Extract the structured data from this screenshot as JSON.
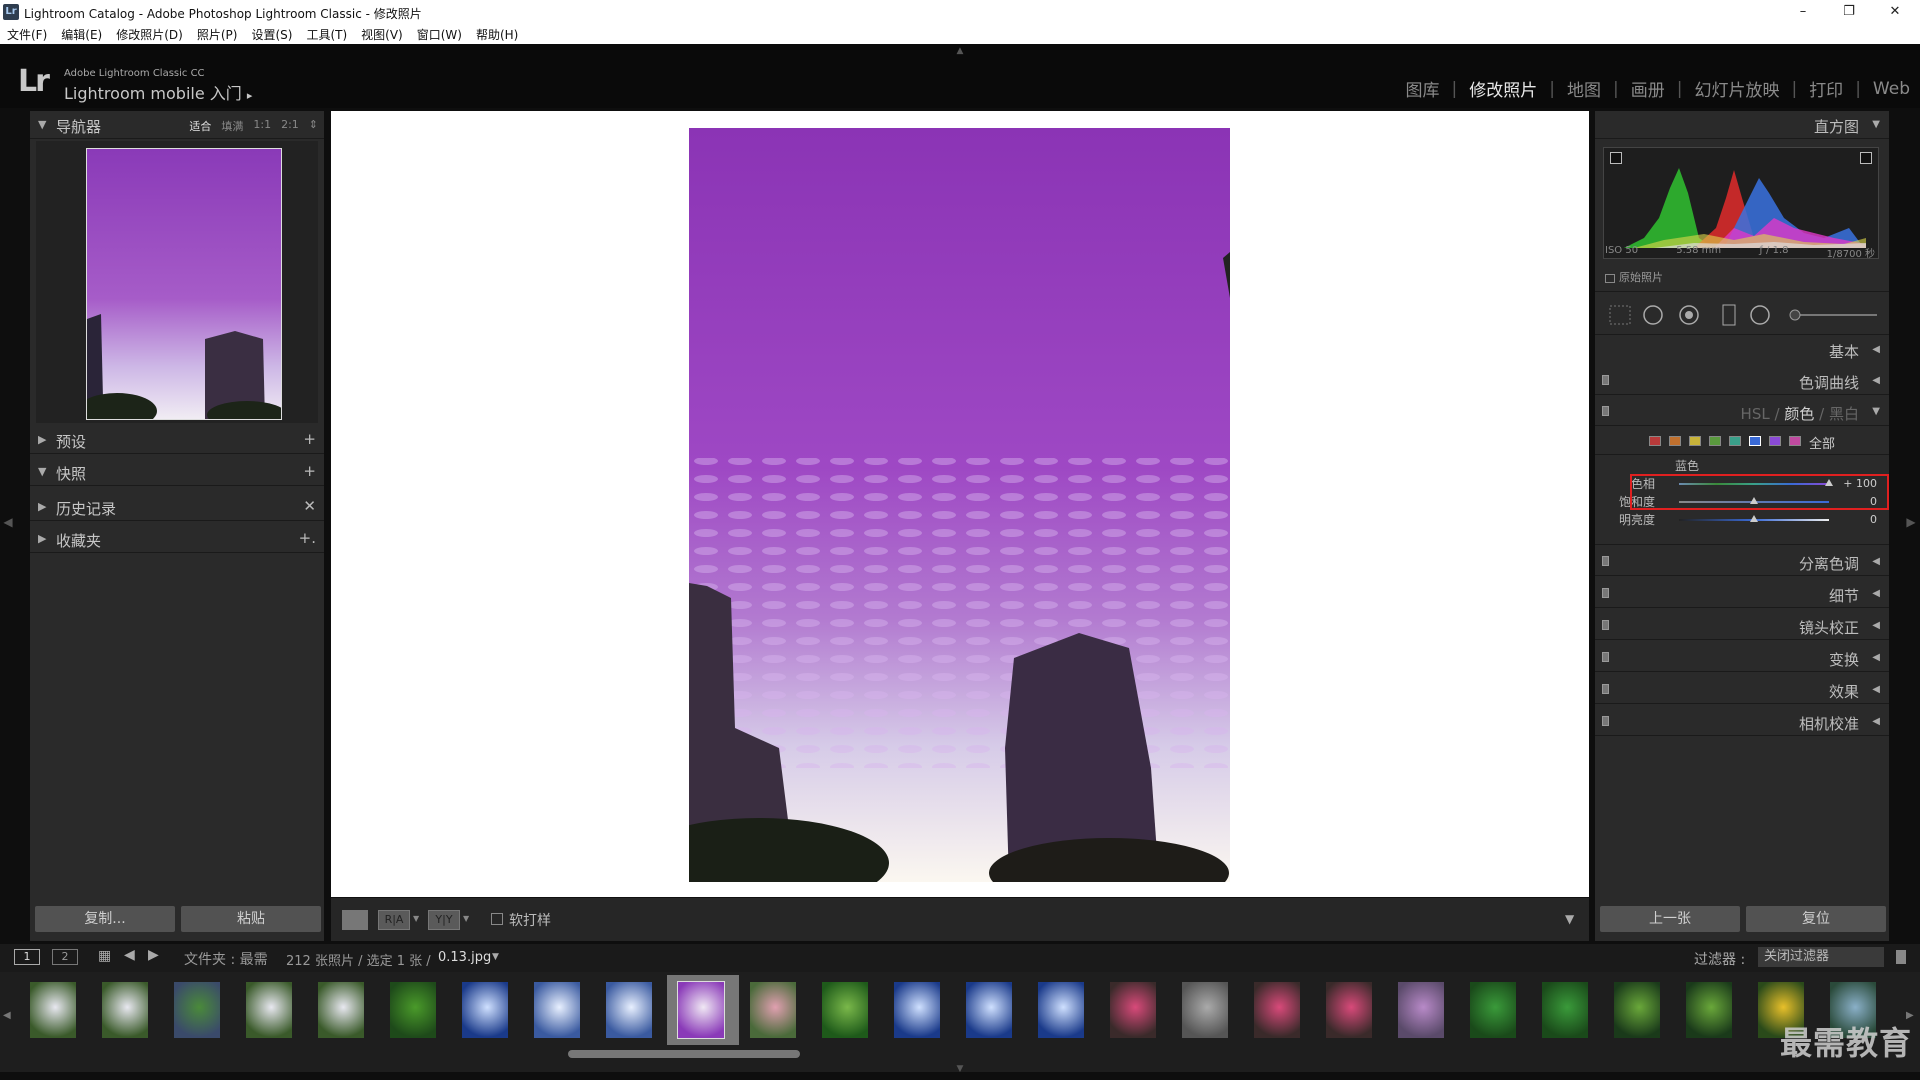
{
  "window": {
    "title": "Lightroom Catalog - Adobe Photoshop Lightroom Classic - 修改照片",
    "logo_text": "Lr",
    "minimize": "–",
    "restore": "❐",
    "close": "✕"
  },
  "menu": [
    "文件(F)",
    "编辑(E)",
    "修改照片(D)",
    "照片(P)",
    "设置(S)",
    "工具(T)",
    "视图(V)",
    "窗口(W)",
    "帮助(H)"
  ],
  "identity": {
    "lr": "Lr",
    "product": "Adobe Lightroom Classic CC",
    "mobile": "Lightroom mobile 入门",
    "arrow": "▸"
  },
  "modules": [
    "图库",
    "修改照片",
    "地图",
    "画册",
    "幻灯片放映",
    "打印",
    "Web"
  ],
  "active_module": "修改照片",
  "left_panel": {
    "navigator": {
      "label": "导航器",
      "options": [
        "适合",
        "填满",
        "1:1",
        "2:1"
      ],
      "dropdown": "⇕"
    },
    "sections": [
      {
        "label": "预设",
        "action": "+"
      },
      {
        "label": "快照",
        "action": "+"
      },
      {
        "label": "历史记录",
        "action": "✕"
      },
      {
        "label": "收藏夹",
        "action": "+."
      }
    ],
    "copy_button": "复制...",
    "paste_button": "粘贴"
  },
  "toolbar": {
    "view_ra": "R|A",
    "view_yy": "Y|Y",
    "softproof_label": "软打样",
    "softproof_checked": false
  },
  "right_panel": {
    "histogram_label": "直方图",
    "hist_info": [
      "ISO 50",
      "5.58 mm",
      "ƒ / 1.8",
      "1/8700 秒"
    ],
    "original_photo": "原始照片",
    "sections_top": [
      {
        "label": "基本"
      },
      {
        "label": "色调曲线"
      }
    ],
    "hsl_tabs": [
      "HSL",
      "/",
      "颜色",
      "/",
      "黑白"
    ],
    "hsl_active": "颜色",
    "color_all": "全部",
    "swatch_colors": [
      "#b83a3a",
      "#c0702e",
      "#c8b33a",
      "#5a9a3e",
      "#3aa08a",
      "#3a6ad6",
      "#8a4ad6",
      "#c04aa0"
    ],
    "selected_color_label": "蓝色",
    "sliders": [
      {
        "label": "色相",
        "value": "+ 100",
        "level": 1.0
      },
      {
        "label": "饱和度",
        "value": "0",
        "level": 0.5
      },
      {
        "label": "明亮度",
        "value": "0",
        "level": 0.5
      }
    ],
    "sections_bottom": [
      {
        "label": "分离色调"
      },
      {
        "label": "细节"
      },
      {
        "label": "镜头校正"
      },
      {
        "label": "变换"
      },
      {
        "label": "效果"
      },
      {
        "label": "相机校准"
      }
    ],
    "prev_button": "上一张",
    "reset_button": "复位"
  },
  "filmstrip_bar": {
    "view1": "1",
    "view2": "2",
    "source": "文件夹 : 最需",
    "count": "212 张照片 / 选定 1 张 /",
    "filename": "0.13.jpg",
    "filter_label": "过滤器 :",
    "filter_value": "关闭过滤器"
  },
  "filmstrip_thumbs": [
    "white-flowers",
    "white-flowers",
    "potted-plant",
    "white-flowers",
    "white-flowers",
    "green-leaves",
    "blue-sky",
    "sky-clouds",
    "sky-clouds",
    "purple-sky",
    "pink-flowers",
    "green-plants",
    "blue-sky",
    "blue-sky",
    "blue-sky",
    "pink-flower",
    "street",
    "pink-flower",
    "pink-flower",
    "hydrangea",
    "green-leaf",
    "green-leaf",
    "fern",
    "fern",
    "yellow-flowers",
    "plant"
  ],
  "selected_thumb": 9,
  "watermark": "最需教育"
}
